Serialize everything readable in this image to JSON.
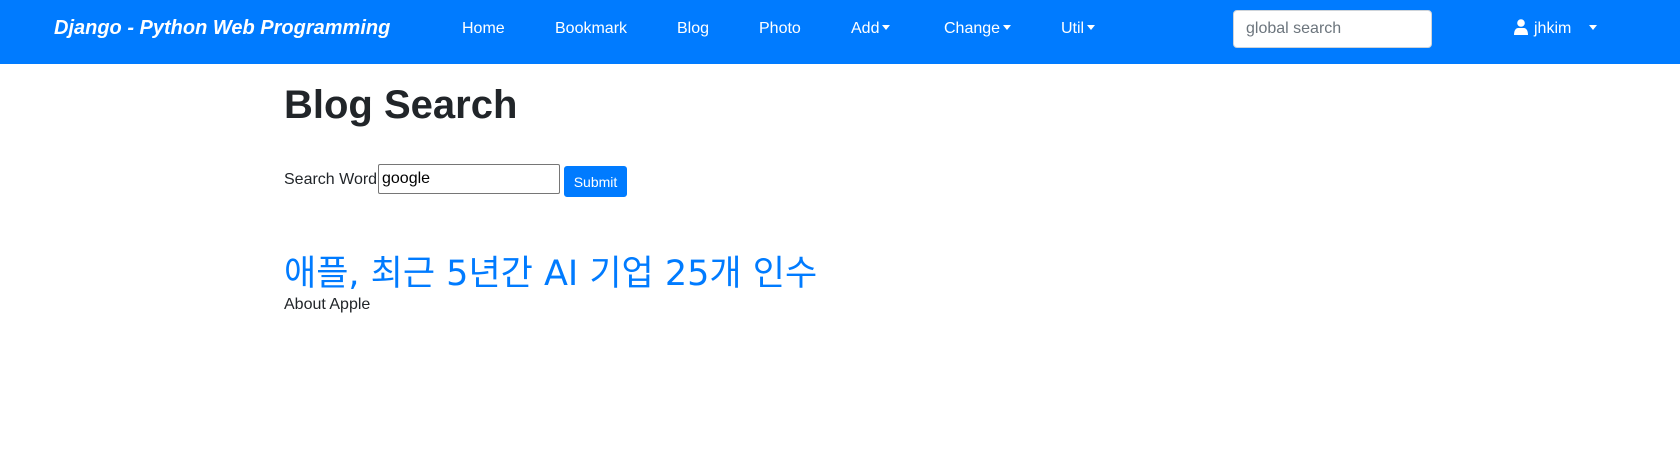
{
  "navbar": {
    "brand": "Django - Python Web Programming",
    "items": [
      {
        "label": "Home",
        "dropdown": false
      },
      {
        "label": "Bookmark",
        "dropdown": false
      },
      {
        "label": "Blog",
        "dropdown": false
      },
      {
        "label": "Photo",
        "dropdown": false
      },
      {
        "label": "Add",
        "dropdown": true
      },
      {
        "label": "Change",
        "dropdown": true
      },
      {
        "label": "Util",
        "dropdown": true
      }
    ],
    "search_placeholder": "global search",
    "user": {
      "name": "jhkim",
      "icon": "user-icon"
    },
    "bg_color": "#007bff"
  },
  "main": {
    "title": "Blog Search",
    "form": {
      "label": "Search Word:",
      "value": "google",
      "submit_label": "Submit"
    },
    "results": [
      {
        "title": "애플, 최근 5년간 AI 기업 25개 인수",
        "description": "About Apple"
      }
    ]
  },
  "colors": {
    "primary": "#007bff",
    "text": "#212529"
  }
}
